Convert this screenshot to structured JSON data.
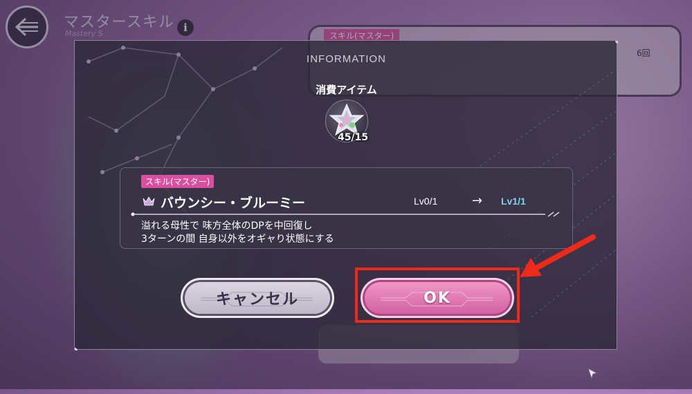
{
  "header": {
    "title": "マスタースキル",
    "subtitle": "Mastery S"
  },
  "background": {
    "panel_tag": "スキル(マスター)",
    "panel_count": "6回"
  },
  "modal": {
    "title": "INFORMATION",
    "consume_label": "消費アイテム",
    "item": {
      "icon": "crystal-star-icon",
      "count": "45/15"
    },
    "skill": {
      "tag": "スキル(マスター)",
      "name": "バウンシー・ブルーミー",
      "level_from": "Lv0/1",
      "arrow": "→",
      "level_to": "Lv1/1",
      "description_line1": "溢れる母性で 味方全体のDPを中回復し",
      "description_line2": "3ターンの間 自身以外をオギャり状態にする"
    },
    "buttons": {
      "cancel_label": "キャンセル",
      "ok_label": "OK"
    }
  },
  "colors": {
    "accent_pink": "#d94f9f",
    "level_up_blue": "#7fd3f0",
    "annotation_red": "#ee2a1a"
  }
}
